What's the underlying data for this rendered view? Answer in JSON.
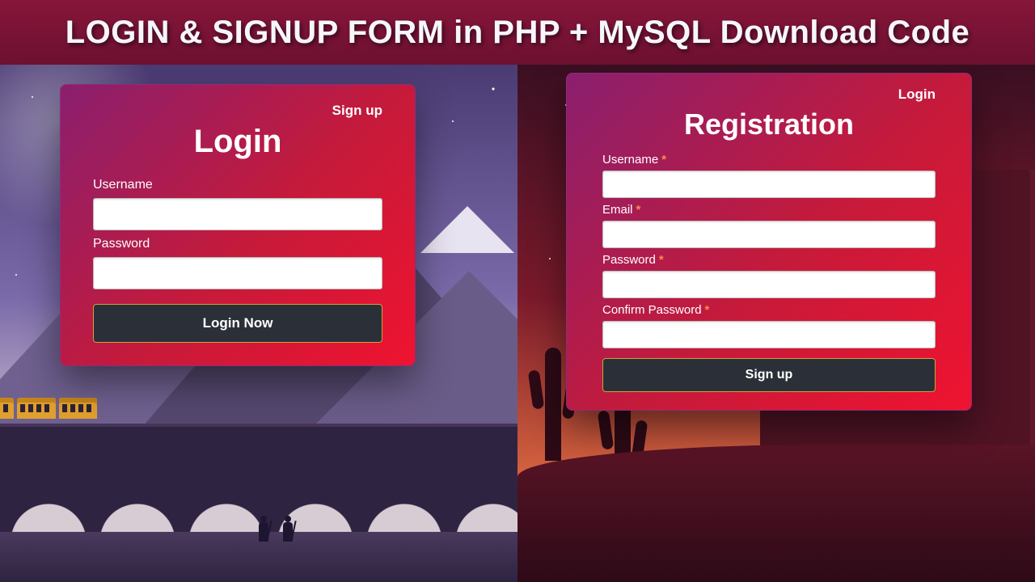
{
  "banner": {
    "title": "LOGIN & SIGNUP FORM in PHP + MySQL Download Code"
  },
  "login_card": {
    "toplink": "Sign up",
    "heading": "Login",
    "fields": {
      "username": {
        "label": "Username"
      },
      "password": {
        "label": "Password"
      }
    },
    "button": "Login Now"
  },
  "signup_card": {
    "toplink": "Login",
    "heading": "Registration",
    "required_marker": "*",
    "fields": {
      "username": {
        "label": "Username"
      },
      "email": {
        "label": "Email"
      },
      "password": {
        "label": "Password"
      },
      "confirm": {
        "label": "Confirm Password"
      }
    },
    "button": "Sign up"
  }
}
